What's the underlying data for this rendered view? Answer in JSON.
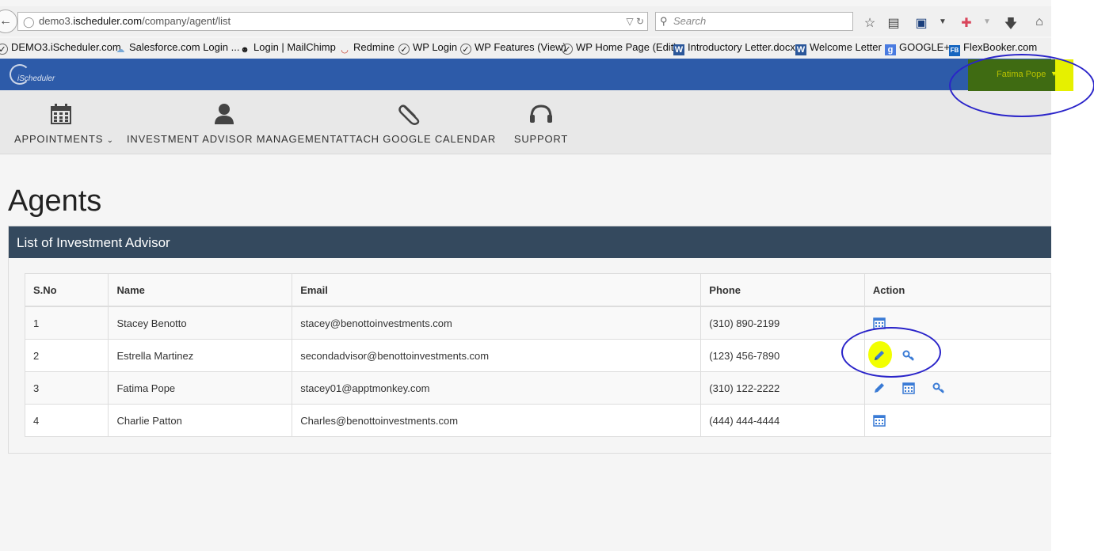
{
  "browser": {
    "url_prefix": "demo3.",
    "url_host": "ischeduler.com",
    "url_path": "/company/agent/list",
    "search_placeholder": "Search"
  },
  "bookmarks": [
    {
      "label": "DEMO3.iScheduler.com"
    },
    {
      "label": "Salesforce.com Login ..."
    },
    {
      "label": "Login | MailChimp"
    },
    {
      "label": "Redmine"
    },
    {
      "label": "WP Login"
    },
    {
      "label": "WP Features (View)"
    },
    {
      "label": "WP Home Page (Edit)"
    },
    {
      "label": "Introductory Letter.docx"
    },
    {
      "label": "Welcome Letter"
    },
    {
      "label": "GOOGLE+"
    },
    {
      "label": "FlexBooker.com"
    }
  ],
  "header": {
    "logo_text": "iScheduler",
    "user_name": "Fatima Pope"
  },
  "nav": [
    {
      "label": "APPOINTMENTS",
      "icon": "calendar-icon"
    },
    {
      "label": "INVESTMENT ADVISOR MANAGEMENT",
      "icon": "user-icon"
    },
    {
      "label": "ATTACH GOOGLE CALENDAR",
      "icon": "paperclip-icon"
    },
    {
      "label": "SUPPORT",
      "icon": "headset-icon"
    }
  ],
  "page_title": "Agents",
  "panel_title": "List of Investment Advisor",
  "table": {
    "headers": [
      "S.No",
      "Name",
      "Email",
      "Phone",
      "Action"
    ],
    "rows": [
      {
        "sno": "1",
        "name": "Stacey Benotto",
        "email": "stacey@benottoinvestments.com",
        "phone": "(310) 890-2199",
        "actions": [
          "calendar"
        ]
      },
      {
        "sno": "2",
        "name": "Estrella Martinez",
        "email": "secondadvisor@benottoinvestments.com",
        "phone": "(123) 456-7890",
        "actions": [
          "edit",
          "key"
        ]
      },
      {
        "sno": "3",
        "name": "Fatima Pope",
        "email": "stacey01@apptmonkey.com",
        "phone": "(310) 122-2222",
        "actions": [
          "edit",
          "calendar",
          "key"
        ]
      },
      {
        "sno": "4",
        "name": "Charlie Patton",
        "email": "Charles@benottoinvestments.com",
        "phone": "(444) 444-4444",
        "actions": [
          "calendar"
        ]
      }
    ]
  },
  "colors": {
    "header_blue": "#2d5ba9",
    "panel_head": "#34495e",
    "icon_blue": "#3a7bd5",
    "highlight_yellow": "#f2ff00",
    "annotation_blue": "#2a24c9"
  }
}
